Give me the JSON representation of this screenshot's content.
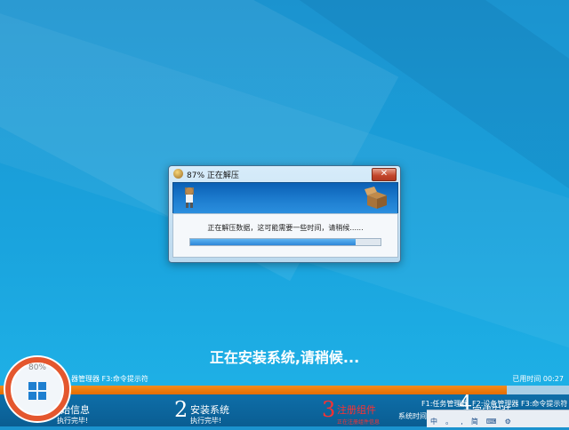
{
  "dialog": {
    "title": "87% 正在解压",
    "close_label": "✕",
    "message": "正在解压数据，这可能需要一些时间，请稍候......",
    "progress": 0.87
  },
  "main_status": "正在安装系统,请稍候...",
  "toprow": {
    "left_text": "器管理器   F3:命令提示符",
    "right_text": "已用时间 00:27"
  },
  "overall_progress": 0.89,
  "steps": [
    {
      "num": "",
      "title": "始信息",
      "sub": "执行完毕!"
    },
    {
      "num": "2",
      "title": "安装系统",
      "sub": "执行完毕!"
    },
    {
      "num": "3",
      "title": "注册组件",
      "sub": "正在注册组件信息"
    },
    {
      "num": "4",
      "title": "完成安装",
      "sub": ""
    }
  ],
  "sys_time_label": "系统时间 2016/12/1",
  "side_hotkeys": [
    "F1:任务管理器",
    "F2:设备管理器",
    "F3:命令提示符"
  ],
  "tray_items": [
    "中",
    "。",
    ",",
    "简"
  ],
  "logo_percent": "80%",
  "colors": {
    "accent_orange": "#e56c00",
    "banner_blue": "#0a60b5",
    "bg": "#1aa3dd"
  }
}
